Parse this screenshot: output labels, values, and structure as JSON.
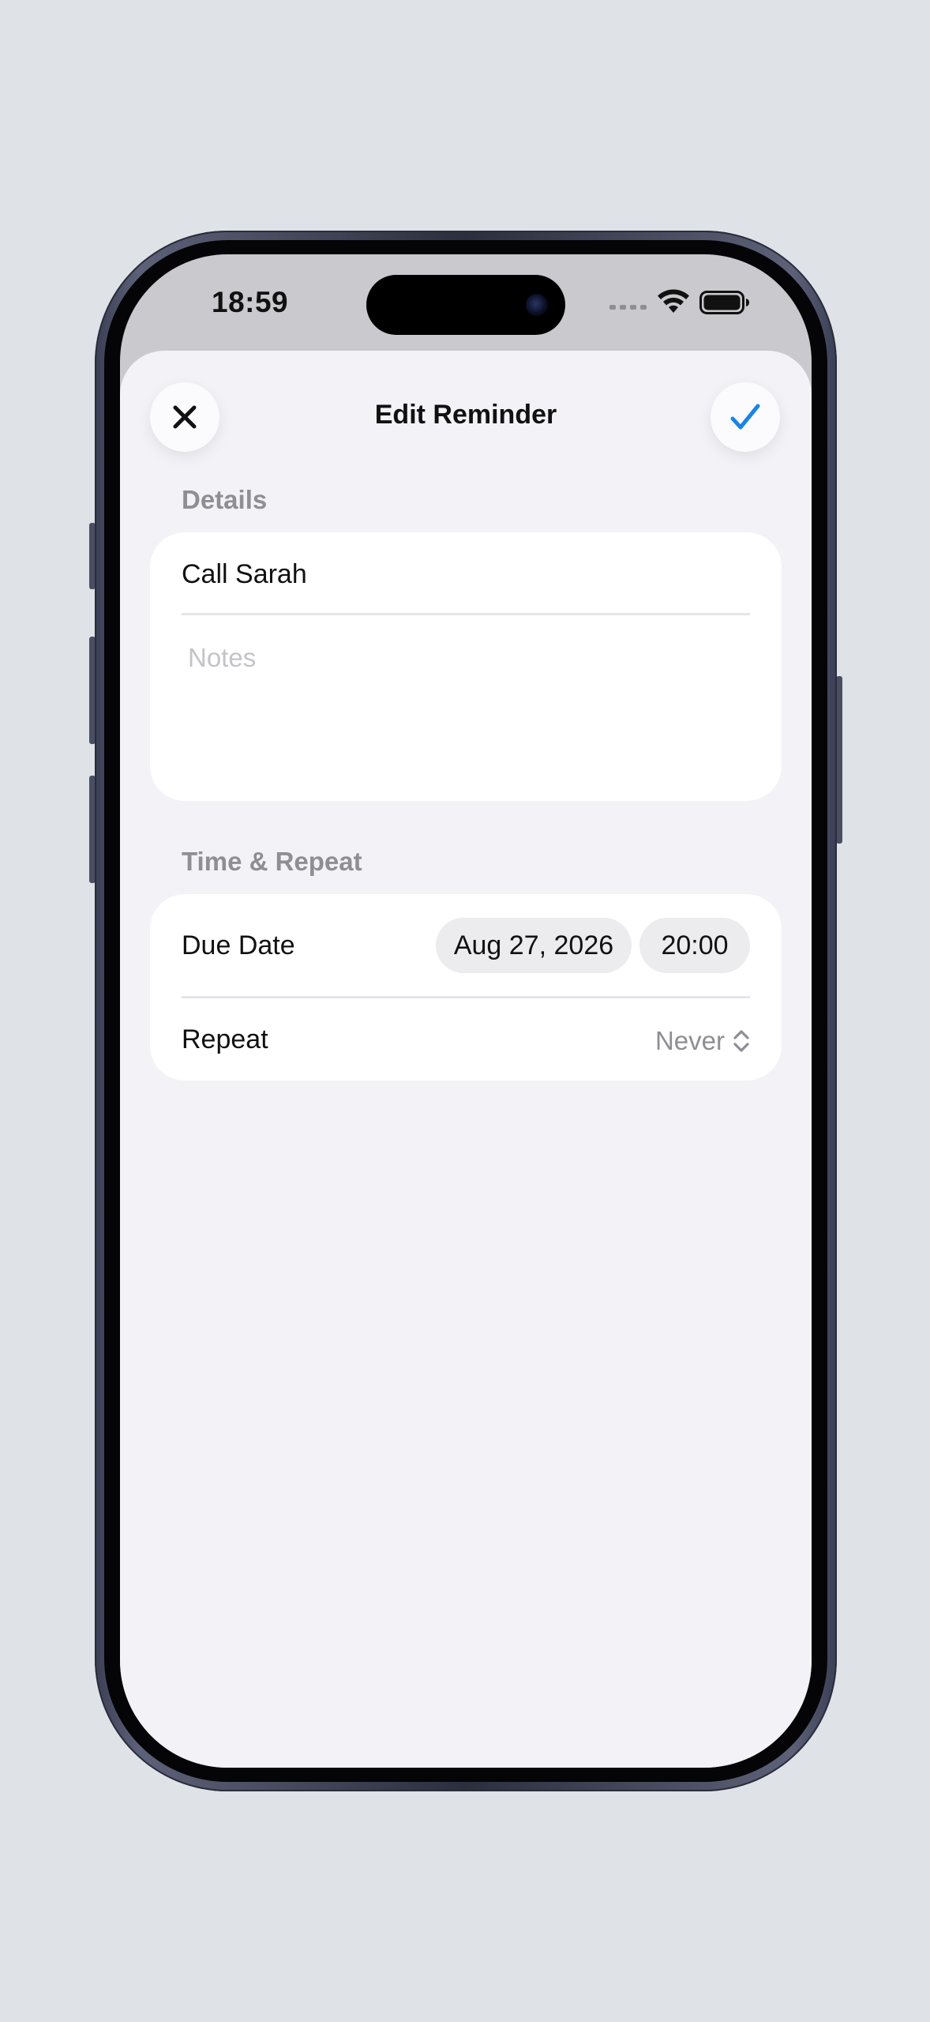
{
  "status_bar": {
    "time": "18:59"
  },
  "sheet": {
    "title": "Edit Reminder",
    "close_icon": "close-icon",
    "done_icon": "checkmark-icon"
  },
  "details": {
    "header": "Details",
    "title_value": "Call Sarah",
    "notes_value": "",
    "notes_placeholder": "Notes"
  },
  "time_repeat": {
    "header": "Time & Repeat",
    "due_label": "Due Date",
    "due_date": "Aug 27, 2026",
    "due_time": "20:00",
    "repeat_label": "Repeat",
    "repeat_value": "Never"
  },
  "colors": {
    "accent": "#1a84e6",
    "sheet_background": "#f2f2f7",
    "secondary_text": "#8e8e93"
  }
}
